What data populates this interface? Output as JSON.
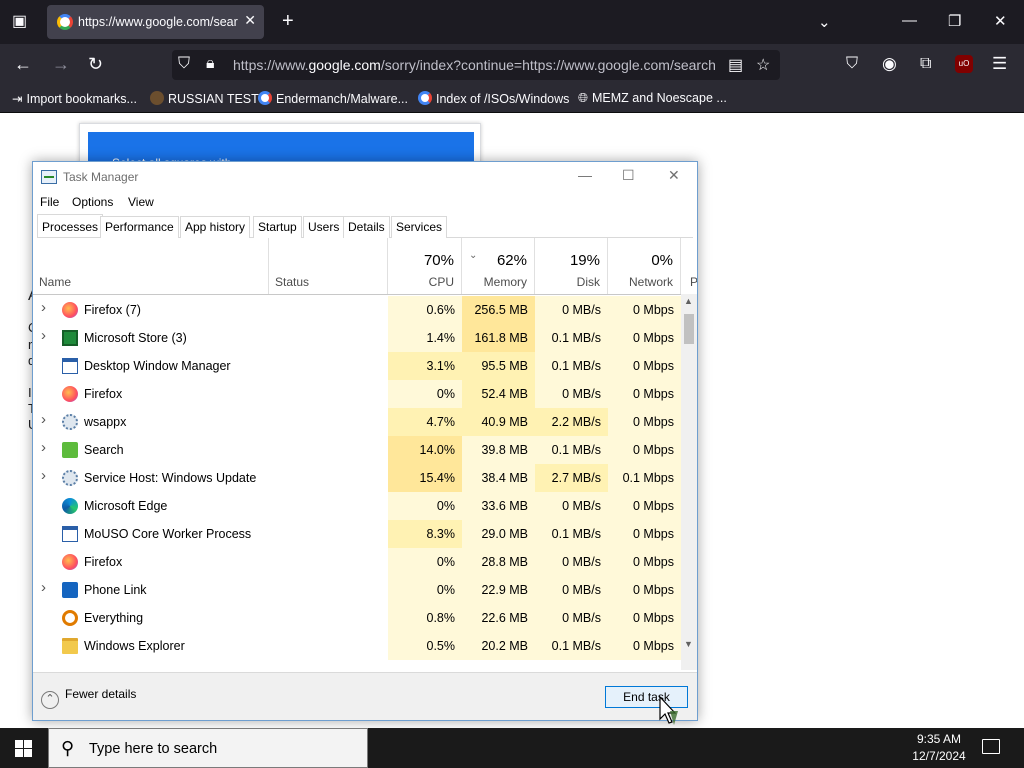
{
  "browser": {
    "tab_title": "https://www.google.com/searc",
    "url_prefix": "https://www.",
    "url_host": "google.com",
    "url_rest": "/sorry/index?continue=https://www.google.com/search",
    "bookmarks": [
      {
        "label": "Import bookmarks...",
        "color": "#fbfbfe"
      },
      {
        "label": "RUSSIAN TEST",
        "color": "#6b4e2e"
      },
      {
        "label": "Endermanch/Malware...",
        "color": "#ffffff"
      },
      {
        "label": "Index of /ISOs/Windows",
        "color": "#ffffff"
      },
      {
        "label": "MEMZ and Noescape ...",
        "color": "#fbfbfe"
      }
    ]
  },
  "page": {
    "captcha_text": "Select all squares with",
    "left_fragments": [
      "A",
      "C",
      "r",
      "d",
      "I",
      "T",
      "U"
    ]
  },
  "task_manager": {
    "title": "Task Manager",
    "menu": [
      "File",
      "Options",
      "View"
    ],
    "tabs": [
      "Processes",
      "Performance",
      "App history",
      "Startup",
      "Users",
      "Details",
      "Services"
    ],
    "columns": {
      "name": "Name",
      "status": "Status",
      "cpu_pct": "70%",
      "cpu": "CPU",
      "mem_pct": "62%",
      "mem": "Memory",
      "disk_pct": "19%",
      "disk": "Disk",
      "net_pct": "0%",
      "net": "Network",
      "power": "P"
    },
    "processes": [
      {
        "name": "Firefox (7)",
        "expandable": true,
        "icon": "firefox-icon",
        "cpu": "0.6%",
        "mem": "256.5 MB",
        "disk": "0 MB/s",
        "net": "0 Mbps"
      },
      {
        "name": "Microsoft Store (3)",
        "expandable": true,
        "icon": "store-icon",
        "cpu": "1.4%",
        "mem": "161.8 MB",
        "disk": "0.1 MB/s",
        "net": "0 Mbps"
      },
      {
        "name": "Desktop Window Manager",
        "expandable": false,
        "icon": "window-icon",
        "cpu": "3.1%",
        "mem": "95.5 MB",
        "disk": "0.1 MB/s",
        "net": "0 Mbps"
      },
      {
        "name": "Firefox",
        "expandable": false,
        "icon": "firefox-icon",
        "cpu": "0%",
        "mem": "52.4 MB",
        "disk": "0 MB/s",
        "net": "0 Mbps"
      },
      {
        "name": "wsappx",
        "expandable": true,
        "icon": "gear-icon",
        "cpu": "4.7%",
        "mem": "40.9 MB",
        "disk": "2.2 MB/s",
        "net": "0 Mbps"
      },
      {
        "name": "Search",
        "expandable": true,
        "icon": "search-app-icon",
        "cpu": "14.0%",
        "mem": "39.8 MB",
        "disk": "0.1 MB/s",
        "net": "0 Mbps"
      },
      {
        "name": "Service Host: Windows Update",
        "expandable": true,
        "icon": "gear-icon",
        "cpu": "15.4%",
        "mem": "38.4 MB",
        "disk": "2.7 MB/s",
        "net": "0.1 Mbps"
      },
      {
        "name": "Microsoft Edge",
        "expandable": false,
        "icon": "edge-icon",
        "cpu": "0%",
        "mem": "33.6 MB",
        "disk": "0 MB/s",
        "net": "0 Mbps"
      },
      {
        "name": "MoUSO Core Worker Process",
        "expandable": false,
        "icon": "window-icon",
        "cpu": "8.3%",
        "mem": "29.0 MB",
        "disk": "0.1 MB/s",
        "net": "0 Mbps"
      },
      {
        "name": "Firefox",
        "expandable": false,
        "icon": "firefox-icon",
        "cpu": "0%",
        "mem": "28.8 MB",
        "disk": "0 MB/s",
        "net": "0 Mbps"
      },
      {
        "name": "Phone Link",
        "expandable": true,
        "icon": "phone-link-icon",
        "cpu": "0%",
        "mem": "22.9 MB",
        "disk": "0 MB/s",
        "net": "0 Mbps"
      },
      {
        "name": "Everything",
        "expandable": false,
        "icon": "everything-icon",
        "cpu": "0.8%",
        "mem": "22.6 MB",
        "disk": "0 MB/s",
        "net": "0 Mbps"
      },
      {
        "name": "Windows Explorer",
        "expandable": false,
        "icon": "folder-icon",
        "cpu": "0.5%",
        "mem": "20.2 MB",
        "disk": "0.1 MB/s",
        "net": "0 Mbps"
      }
    ],
    "fewer_details": "Fewer details",
    "end_task": "End task"
  },
  "taskbar": {
    "search_placeholder": "Type here to search",
    "time": "9:35 AM",
    "date": "12/7/2024"
  },
  "colors": {
    "heat_light": "#fff9d9",
    "heat_mid": "#fff2b3",
    "heat_strong": "#ffe79a",
    "accent": "#0078d7"
  }
}
